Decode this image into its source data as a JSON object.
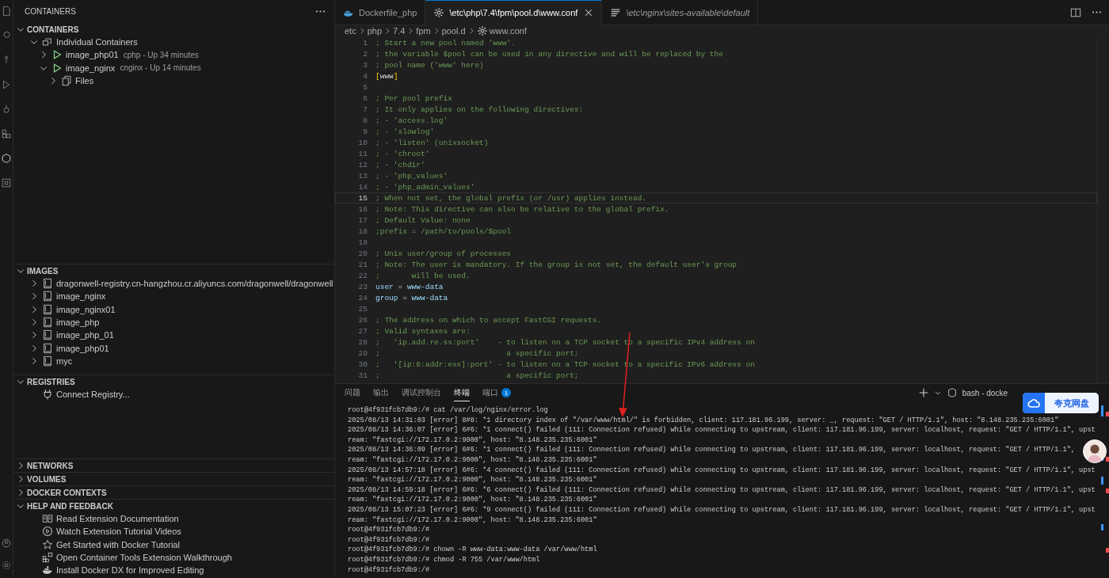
{
  "sidebar": {
    "title": "CONTAINERS",
    "sections": [
      {
        "title": "CONTAINERS",
        "expanded": true,
        "items": [
          {
            "label": "Individual Containers",
            "kind": "group",
            "expanded": true,
            "children": [
              {
                "label": "image_php01",
                "description": "cphp - Up 34 minutes",
                "kind": "container",
                "expanded": false
              },
              {
                "label": "image_nginx",
                "description": "cnginx - Up 14 minutes",
                "kind": "container",
                "expanded": true,
                "children": [
                  {
                    "label": "Files",
                    "kind": "files",
                    "expanded": false
                  }
                ]
              }
            ]
          }
        ]
      },
      {
        "title": "IMAGES",
        "expanded": true,
        "items": [
          {
            "label": "dragonwell-registry.cn-hangzhou.cr.aliyuncs.com/dragonwell/dragonwell",
            "kind": "image",
            "expanded": false
          },
          {
            "label": "image_nginx",
            "kind": "image",
            "expanded": false
          },
          {
            "label": "image_nginx01",
            "kind": "image",
            "expanded": false
          },
          {
            "label": "image_php",
            "kind": "image",
            "expanded": false
          },
          {
            "label": "image_php_01",
            "kind": "image",
            "expanded": false
          },
          {
            "label": "image_php01",
            "kind": "image",
            "expanded": false
          },
          {
            "label": "myc",
            "kind": "image",
            "expanded": false
          }
        ]
      },
      {
        "title": "REGISTRIES",
        "expanded": true,
        "items": [
          {
            "label": "Connect Registry...",
            "kind": "plug"
          }
        ]
      },
      {
        "title": "NETWORKS",
        "expanded": false
      },
      {
        "title": "VOLUMES",
        "expanded": false
      },
      {
        "title": "DOCKER CONTEXTS",
        "expanded": false
      },
      {
        "title": "HELP AND FEEDBACK",
        "expanded": true,
        "items": [
          {
            "label": "Read Extension Documentation",
            "kind": "book"
          },
          {
            "label": "Watch Extension Tutorial Videos",
            "kind": "play"
          },
          {
            "label": "Get Started with Docker Tutorial",
            "kind": "star"
          },
          {
            "label": "Open Container Tools Extension Walkthrough",
            "kind": "walkthrough"
          },
          {
            "label": "Install Docker DX for Improved Editing",
            "kind": "whale"
          }
        ]
      }
    ]
  },
  "editor": {
    "tabs": [
      {
        "label": "Dockerfile_php",
        "kind": "docker",
        "selected": false,
        "italic": false
      },
      {
        "label": "\\etc\\php\\7.4\\fpm\\pool.d\\www.conf",
        "kind": "gear",
        "selected": true,
        "italic": false
      },
      {
        "label": "\\etc\\nginx\\sites-available\\default",
        "kind": "lines",
        "selected": false,
        "italic": true
      }
    ],
    "breadcrumb": [
      "etc",
      "php",
      "7.4",
      "fpm",
      "pool.d",
      "www.conf"
    ],
    "lines": [
      {
        "n": "1",
        "kind": "comment",
        "text": "; Start a new pool named 'www'.",
        "current": false
      },
      {
        "n": "2",
        "kind": "comment",
        "text": "; the variable $pool can be used in any directive and will be replaced by the",
        "current": false
      },
      {
        "n": "3",
        "kind": "comment",
        "text": "; pool name ('www' here)",
        "current": false
      },
      {
        "n": "4",
        "kind": "section",
        "text": "[www]",
        "current": false
      },
      {
        "n": "5",
        "kind": "blank",
        "current": false
      },
      {
        "n": "6",
        "kind": "comment",
        "text": "; Per pool prefix",
        "current": false
      },
      {
        "n": "7",
        "kind": "comment",
        "text": "; It only applies on the following directives:",
        "current": false
      },
      {
        "n": "8",
        "kind": "comment",
        "text": "; - 'access.log'",
        "current": false
      },
      {
        "n": "9",
        "kind": "comment",
        "text": "; - 'slowlog'",
        "current": false
      },
      {
        "n": "10",
        "kind": "comment",
        "text": "; - 'listen' (unixsocket)",
        "current": false
      },
      {
        "n": "11",
        "kind": "comment",
        "text": "; - 'chroot'",
        "current": false
      },
      {
        "n": "12",
        "kind": "comment",
        "text": "; - 'chdir'",
        "current": false
      },
      {
        "n": "13",
        "kind": "comment",
        "text": "; - 'php_values'",
        "current": false
      },
      {
        "n": "14",
        "kind": "comment",
        "text": "; - 'php_admin_values'",
        "current": false
      },
      {
        "n": "15",
        "kind": "comment",
        "text": "; When not set, the global prefix (or /usr) applies instead.",
        "current": true
      },
      {
        "n": "16",
        "kind": "comment",
        "text": "; Note: This directive can also be relative to the global prefix.",
        "current": false
      },
      {
        "n": "17",
        "kind": "comment",
        "text": "; Default Value: none",
        "current": false
      },
      {
        "n": "18",
        "kind": "comment",
        "text": ";prefix = /path/to/pools/$pool",
        "current": false
      },
      {
        "n": "19",
        "kind": "blank",
        "current": false
      },
      {
        "n": "20",
        "kind": "comment",
        "text": "; Unix user/group of processes",
        "current": false
      },
      {
        "n": "21",
        "kind": "comment",
        "text": "; Note: The user is mandatory. If the group is not set, the default user's group",
        "current": false
      },
      {
        "n": "22",
        "kind": "comment",
        "text": ";       will be used.",
        "current": false
      },
      {
        "n": "23",
        "kind": "setting",
        "text": "user = www-data",
        "current": false
      },
      {
        "n": "24",
        "kind": "setting",
        "text": "group = www-data",
        "current": false
      },
      {
        "n": "25",
        "kind": "blank",
        "current": false
      },
      {
        "n": "26",
        "kind": "comment",
        "text": "; The address on which to accept FastCGI requests.",
        "current": false
      },
      {
        "n": "27",
        "kind": "comment",
        "text": "; Valid syntaxes are:",
        "current": false
      },
      {
        "n": "28",
        "kind": "comment",
        "text": ";   'ip.add.re.ss:port'    - to listen on a TCP socket to a specific IPv4 address on",
        "current": false
      },
      {
        "n": "29",
        "kind": "comment",
        "text": ";                            a specific port;",
        "current": false
      },
      {
        "n": "30",
        "kind": "comment",
        "text": ";   '[ip:6:addr:ess]:port' - to listen on a TCP socket to a specific IPv6 address on",
        "current": false
      },
      {
        "n": "31",
        "kind": "comment",
        "text": ";                            a specific port;",
        "current": false
      }
    ]
  },
  "panel": {
    "tabs": [
      {
        "label": "问题",
        "selected": false
      },
      {
        "label": "输出",
        "selected": false
      },
      {
        "label": "调试控制台",
        "selected": false
      },
      {
        "label": "终端",
        "selected": true
      },
      {
        "label": "端口",
        "selected": false,
        "badge": "1"
      }
    ],
    "terminal_title": "bash - docke",
    "lines": [
      "root@4f931fcb7db9:/# cat /var/log/nginx/error.log",
      "2025/08/13 14:31:03 [error] 8#8: *1 directory index of \"/var/www/html/\" is forbidden, client: 117.181.96.199, server: _, request: \"GET / HTTP/1.1\", host: \"8.148.235.235:6001\"",
      "2025/08/13 14:36:07 [error] 6#6: *1 connect() failed (111: Connection refused) while connecting to upstream, client: 117.181.96.199, server: localhost, request: \"GET / HTTP/1.1\", upst",
      "ream: \"fastcgi://172.17.0.2:9000\", host: \"8.148.235.235:6001\"",
      "2025/08/13 14:36:09 [error] 6#6: *1 connect() failed (111: Connection refused) while connecting to upstream, client: 117.181.96.199, server: localhost, request: \"GET / HTTP/1.1\",",
      "ream: \"fastcgi://172.17.0.2:9000\", host: \"8.148.235.235:6001\"",
      "2025/08/13 14:57:18 [error] 6#6: *4 connect() failed (111: Connection refused) while connecting to upstream, client: 117.181.96.199, server: localhost, request: \"GET / HTTP/1.1\", upst",
      "ream: \"fastcgi://172.17.0.2:9000\", host: \"8.148.235.235:6001\"",
      "2025/08/13 14:59:18 [error] 6#6: *6 connect() failed (111: Connection refused) while connecting to upstream, client: 117.181.96.199, server: localhost, request: \"GET / HTTP/1.1\", upst",
      "ream: \"fastcgi://172.17.0.2:9000\", host: \"8.148.235.235:6001\"",
      "2025/08/13 15:07:23 [error] 6#6: *9 connect() failed (111: Connection refused) while connecting to upstream, client: 117.181.96.199, server: localhost, request: \"GET / HTTP/1.1\", upst",
      "ream: \"fastcgi://172.17.0.2:9000\", host: \"8.148.235.235:6001\"",
      "root@4f931fcb7db9:/#",
      "root@4f931fcb7db9:/#",
      "root@4f931fcb7db9:/# chown -R www-data:www-data /var/www/html",
      "root@4f931fcb7db9:/# chmod -R 755 /var/www/html",
      "root@4f931fcb7db9:/#"
    ]
  },
  "overlay": {
    "cloud_button": "夸克网盘"
  }
}
